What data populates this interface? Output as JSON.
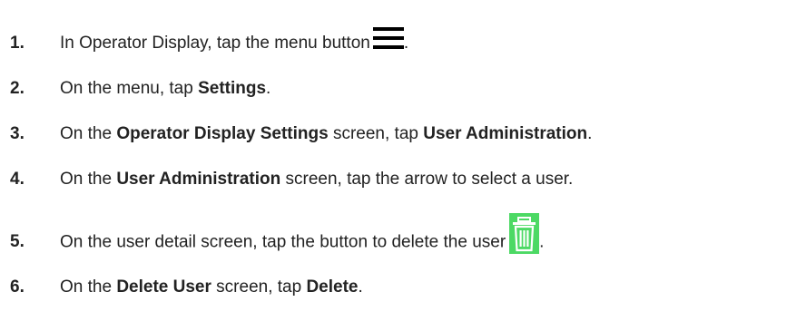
{
  "steps": [
    {
      "number": "1.",
      "parts": [
        "In Operator Display, tap the menu button",
        "."
      ],
      "icon": "menu-icon"
    },
    {
      "number": "2.",
      "parts": [
        "On the menu, tap ",
        "Settings",
        "."
      ]
    },
    {
      "number": "3.",
      "parts": [
        "On the ",
        "Operator Display Settings",
        " screen, tap ",
        "User Administration",
        "."
      ]
    },
    {
      "number": "4.",
      "parts": [
        "On the ",
        "User Administration",
        " screen, tap the arrow to select a user."
      ]
    },
    {
      "number": "5.",
      "parts": [
        "On the user detail screen, tap the button to delete the user",
        "."
      ],
      "icon": "trash-icon",
      "icon_color": "#4CD964"
    },
    {
      "number": "6.",
      "parts": [
        "On the ",
        "Delete User",
        " screen, tap ",
        "Delete",
        "."
      ]
    }
  ]
}
